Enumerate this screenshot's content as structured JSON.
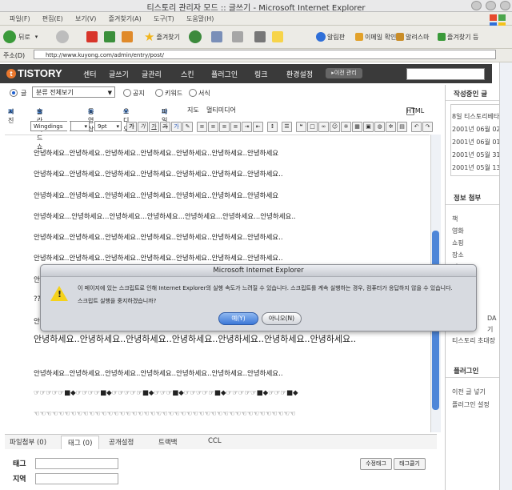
{
  "window": {
    "title": "티스토리 관리자 모드 :: 글쓰기 - Microsoft Internet Explorer"
  },
  "menu": [
    "파일(F)",
    "편집(E)",
    "보기(V)",
    "즐겨찾기(A)",
    "도구(T)",
    "도움말(H)"
  ],
  "toolbar": {
    "back": "뒤로",
    "favorites": "즐겨찾기",
    "link1": "알림판",
    "link2": "이메일 확인",
    "link3": "알려스마",
    "link4": "즐겨찾기 등"
  },
  "address": {
    "label": "주소(D)",
    "url": "http://www.kuyong.com/admin/entry/post/"
  },
  "nav": {
    "logo": "TISTORY",
    "items": [
      "센터",
      "글쓰기",
      "글관리",
      "스킨",
      "플러그인",
      "링크",
      "환경설정"
    ],
    "button": "▸이전 관리"
  },
  "options": {
    "label": "글",
    "category": "분류 전체보기",
    "public": "공지",
    "keyword": "키워드",
    "notice": "서식"
  },
  "tools1": [
    "시진",
    "슬라이드쇼",
    "동영상",
    "오디오",
    "파일",
    "지도",
    "멀티미디어"
  ],
  "html_label": "HTML",
  "font": {
    "family": "Wingdings",
    "size": "9pt"
  },
  "editor": {
    "lines": [
      "안녕하세요..안녕하세요..안녕하세요..안녕하세요..안녕하세요..안녕하세요..안녕하세요",
      "안녕하세요..안녕하세요..안녕하세요..안녕하세요..안녕하세요..안녕하세요..안녕하세요..",
      "안녕하세요..안녕하세요..안녕하세요..안녕하세요..안녕하세요..안녕하세요..안녕하세요",
      "안녕하세요...안녕하세요...안녕하세요...안녕하세요...안녕하세요...안녕하세요...안녕하세요..",
      "안녕하세요..안녕하세요..안녕하세요..안녕하세요..안녕하세요..안녕하세요..안녕하세요..",
      "안녕하세요..안녕하세요..안녕하세요..안녕하세요..안녕하세요..안녕하세요..안녕하세요.."
    ],
    "partial1": "안",
    "partial2": "??",
    "partial3": "안",
    "big_line": "안녕하세요..안녕하세요..안녕하세요..안녕하세요..안녕하세요..안녕하세요..안녕하세요..",
    "line_after": "안녕하세요..안녕하세요..안녕하세요..안녕하세요..안녕하세요..안녕하세요..안녕하세요..",
    "symbols1": "☞☞☞☞☞■◆☞☞☞☞■◆☞☞☞☞☞■◆☞☞☞■◆☞☞☞☞☞■◆☞☞☞☞☞■◆☞☞☞■◆",
    "symbols2": "☜☜☜☜☜☜☜☜☜☜☜☜☜☜☜☜☜☜☜☜☜☜☜☜☜☜☜☜☜☜☜☜☜☜☜☜☜☜☜☜☜☜☜"
  },
  "tabs": [
    "파일첨부 (0)",
    "태그 (0)",
    "공개설정",
    "트랙백",
    "CCL"
  ],
  "fields": {
    "tag": "태그",
    "location": "지역"
  },
  "buttons": {
    "revise": "수정태그",
    "tagcloud": "태그클기"
  },
  "sidebar": {
    "recent_title": "작성중인 글",
    "recent": [
      "8일 티스토리베타",
      "2001년 06월 02일",
      "2001년 06월 01일",
      "2001년 05월 31일",
      "2001년 05월 13일"
    ],
    "info_title": "정보 첨부",
    "info": [
      "책",
      "영화",
      "쇼핑",
      "장소",
      "지도"
    ],
    "partial_a": "DA",
    "partial_b": "기",
    "invite": "티스토리 초대장",
    "plugin_title": "플러그인",
    "plugin": [
      "이전 글 넣기",
      "플러그인 설정"
    ]
  },
  "dialog": {
    "title": "Microsoft Internet Explorer",
    "message": "이 페이지에 있는 스크립트로 인해 Internet Explorer의 실행 속도가 느려질 수 있습니다. 스크립트를 계속 실행하는 경우, 컴퓨터가 응답하지 않을 수 있습니다.",
    "question": "스크립트 실행을 중지하겠습니까?",
    "yes": "예(Y)",
    "no": "아니오(N)"
  }
}
